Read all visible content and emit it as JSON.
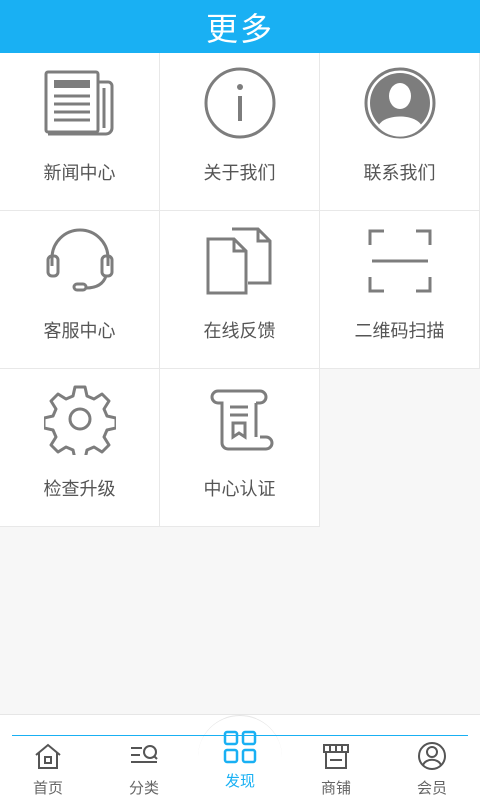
{
  "header": {
    "title": "更多"
  },
  "grid": {
    "items": [
      {
        "label": "新闻中心"
      },
      {
        "label": "关于我们"
      },
      {
        "label": "联系我们"
      },
      {
        "label": "客服中心"
      },
      {
        "label": "在线反馈"
      },
      {
        "label": "二维码扫描"
      },
      {
        "label": "检查升级"
      },
      {
        "label": "中心认证"
      }
    ]
  },
  "tabbar": {
    "tabs": [
      {
        "label": "首页"
      },
      {
        "label": "分类"
      },
      {
        "label": "发现"
      },
      {
        "label": "商铺"
      },
      {
        "label": "会员"
      }
    ],
    "active_color": "#19b0f3"
  },
  "colors": {
    "accent": "#19b0f3",
    "icon": "#7d7d7d"
  }
}
